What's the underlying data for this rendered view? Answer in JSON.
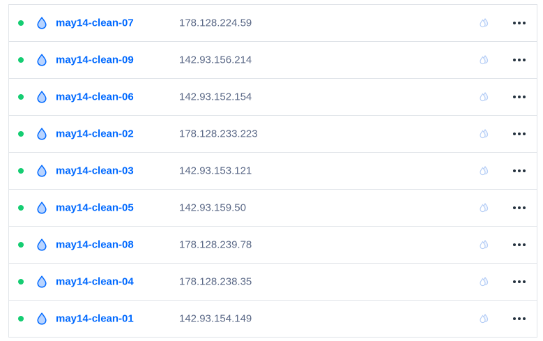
{
  "colors": {
    "status_active": "#15cd72",
    "link": "#0069ff",
    "ip_text": "#5b6987",
    "border": "#dfe3e8"
  },
  "icons": {
    "status": "status-dot-icon",
    "droplet": "droplet-icon",
    "backup": "backup-droplet-icon",
    "more": "more-options-icon"
  },
  "droplets": [
    {
      "name": "may14-clean-07",
      "ip": "178.128.224.59",
      "status": "active"
    },
    {
      "name": "may14-clean-09",
      "ip": "142.93.156.214",
      "status": "active"
    },
    {
      "name": "may14-clean-06",
      "ip": "142.93.152.154",
      "status": "active"
    },
    {
      "name": "may14-clean-02",
      "ip": "178.128.233.223",
      "status": "active"
    },
    {
      "name": "may14-clean-03",
      "ip": "142.93.153.121",
      "status": "active"
    },
    {
      "name": "may14-clean-05",
      "ip": "142.93.159.50",
      "status": "active"
    },
    {
      "name": "may14-clean-08",
      "ip": "178.128.239.78",
      "status": "active"
    },
    {
      "name": "may14-clean-04",
      "ip": "178.128.238.35",
      "status": "active"
    },
    {
      "name": "may14-clean-01",
      "ip": "142.93.154.149",
      "status": "active"
    }
  ]
}
